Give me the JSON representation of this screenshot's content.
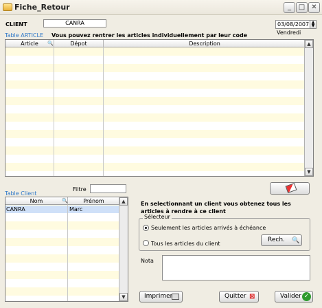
{
  "window": {
    "title": "Fiche_Retour"
  },
  "client": {
    "label": "CLIENT",
    "value": "CANRA"
  },
  "date": {
    "value": "03/08/2007",
    "day": "Vendredi"
  },
  "article": {
    "table_label": "Table ARTICLE",
    "instruction": "Vous pouvez rentrer les articles individuellement par leur code",
    "columns": [
      "Article",
      "Dépot",
      "Description"
    ]
  },
  "client_table": {
    "table_label": "Table Client",
    "filter_label": "Filtre",
    "filter_value": "",
    "columns": [
      "Nom",
      "Prénom"
    ],
    "rows": [
      {
        "nom": "CANRA",
        "prenom": "Marc"
      }
    ]
  },
  "info_text": "En selectionnant un client vous obtenez tous les articles à rendre à  ce client",
  "selector": {
    "title": "Sélecteur",
    "option1": "Seulement les articles arrivés à échéance",
    "option2": "Tous les articles du client",
    "search_button": "Rech.",
    "selected": 1
  },
  "nota": {
    "label": "Nota",
    "value": ""
  },
  "buttons": {
    "print": "Imprimer",
    "quit": "Quitter",
    "validate": "Valider"
  }
}
